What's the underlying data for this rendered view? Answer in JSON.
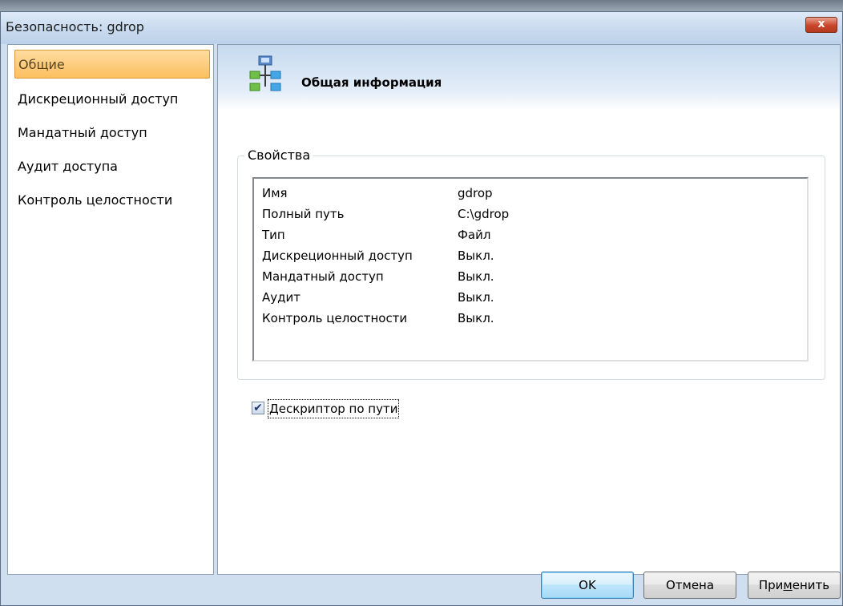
{
  "window": {
    "title": "Безопасность: gdrop",
    "close_glyph": "x"
  },
  "sidebar": {
    "items": [
      {
        "label": "Общие",
        "active": true
      },
      {
        "label": "Дискреционный доступ"
      },
      {
        "label": "Мандатный доступ"
      },
      {
        "label": "Аудит доступа"
      },
      {
        "label": "Контроль целостности"
      }
    ]
  },
  "header": {
    "title": "Общая информация",
    "icon": "network-hierarchy-icon"
  },
  "properties": {
    "group_label": "Свойства",
    "rows": [
      {
        "name": "Имя",
        "value": "gdrop"
      },
      {
        "name": "Полный путь",
        "value": "C:\\gdrop"
      },
      {
        "name": "Тип",
        "value": "Файл"
      },
      {
        "name": "Дискреционный доступ",
        "value": "Выкл."
      },
      {
        "name": "Мандатный доступ",
        "value": "Выкл."
      },
      {
        "name": "Аудит",
        "value": "Выкл."
      },
      {
        "name": "Контроль целостности",
        "value": "Выкл."
      }
    ]
  },
  "options": {
    "descriptor_by_path": {
      "label": "Дескриптор по пути",
      "checked": true,
      "check_glyph": "✔"
    }
  },
  "buttons": {
    "ok": "OK",
    "cancel": "Отмена",
    "apply_prefix": "При",
    "apply_hotkey": "м",
    "apply_suffix": "енить"
  },
  "colors": {
    "active_item": "#fbbf5f",
    "ok_button": "#bee6fd",
    "close_button": "#c9452a"
  }
}
